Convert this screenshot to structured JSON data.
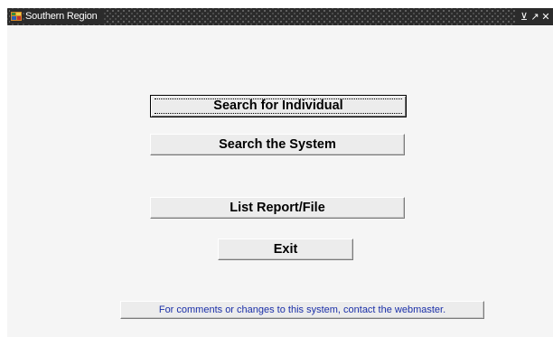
{
  "window": {
    "title": "Southern Region",
    "controls": {
      "minimize_glyph": "⊻",
      "maximize_glyph": "↗",
      "close_glyph": "✕"
    }
  },
  "main": {
    "buttons": {
      "search_individual": "Search for Individual",
      "search_system": "Search the System",
      "list_report": "List Report/File",
      "exit": "Exit"
    },
    "webmaster_link": "For comments or changes to this system, contact the webmaster."
  },
  "colors": {
    "titlebar": "#2b2b2b",
    "content_background": "#f5f5f5",
    "button_face": "#ececec",
    "link_text": "#1a2fa8"
  },
  "icons": {
    "app": "app-icon",
    "minimize": "minimize-icon",
    "maximize": "maximize-icon",
    "close": "close-icon"
  }
}
